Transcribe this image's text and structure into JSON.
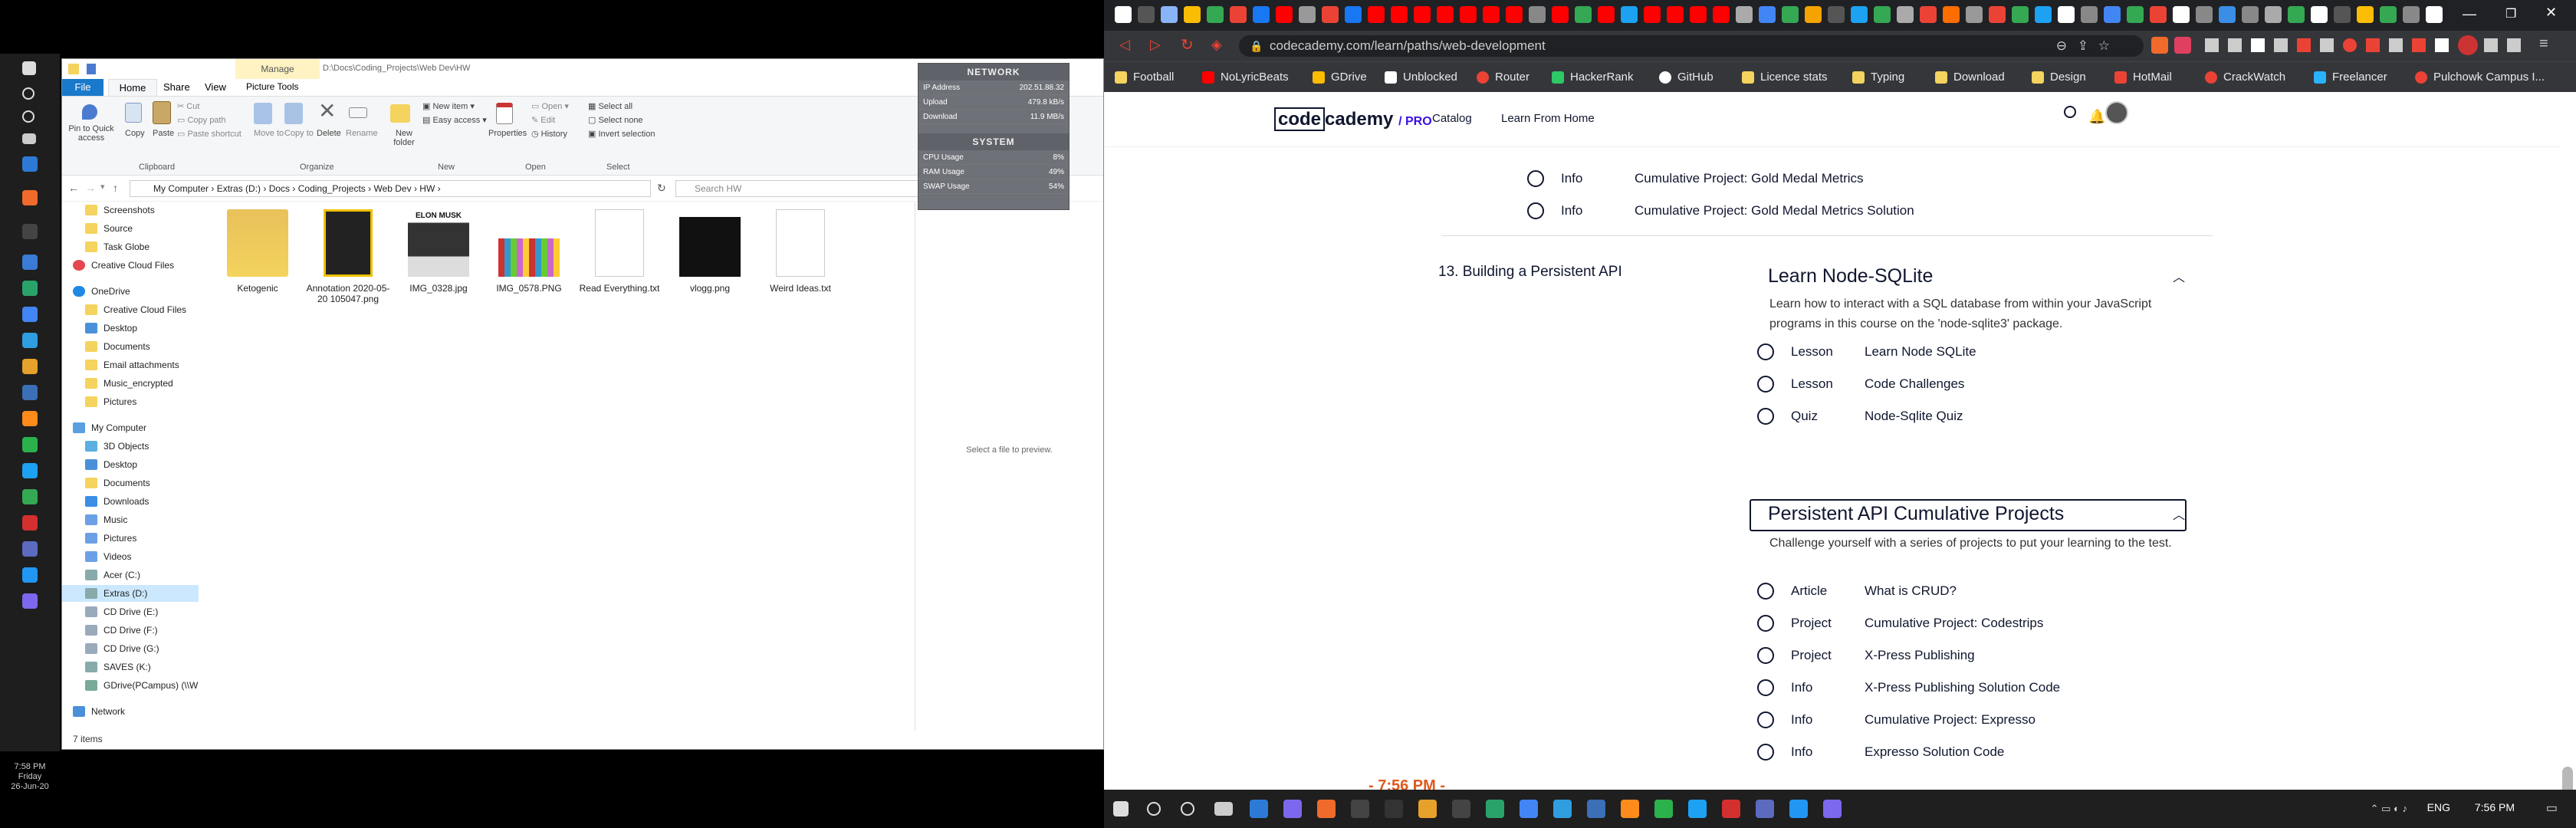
{
  "explorer": {
    "title_path": "D:\\Docs\\Coding_Projects\\Web Dev\\HW",
    "manage_label": "Manage",
    "tabs": [
      "File",
      "Home",
      "Share",
      "View",
      "Picture Tools"
    ],
    "ribbon": {
      "pin": "Pin to Quick access",
      "copy": "Copy",
      "paste": "Paste",
      "cut": "Cut",
      "copy_path": "Copy path",
      "paste_shortcut": "Paste shortcut",
      "move_to": "Move to",
      "copy_to": "Copy to",
      "delete": "Delete",
      "rename": "Rename",
      "new_folder": "New folder",
      "new_item": "New item",
      "easy_access": "Easy access",
      "properties": "Properties",
      "open": "Open",
      "edit": "Edit",
      "history": "History",
      "select_all": "Select all",
      "select_none": "Select none",
      "invert": "Invert selection",
      "groups": [
        "Clipboard",
        "Organize",
        "New",
        "Open",
        "Select"
      ]
    },
    "breadcrumb": [
      "My Computer",
      "Extras (D:)",
      "Docs",
      "Coding_Projects",
      "Web Dev",
      "HW"
    ],
    "search_placeholder": "Search HW",
    "nav": [
      "Screenshots",
      "Source",
      "Task Globe",
      "Creative Cloud Files",
      "OneDrive",
      "Creative Cloud Files",
      "Desktop",
      "Documents",
      "Email attachments",
      "Music_encrypted",
      "Pictures",
      "My Computer",
      "3D Objects",
      "Desktop",
      "Documents",
      "Downloads",
      "Music",
      "Pictures",
      "Videos",
      "Acer (C:)",
      "Extras (D:)",
      "CD Drive (E:)",
      "CD Drive (F:)",
      "CD Drive (G:)",
      "SAVES (K:)",
      "GDrive(PCampus) (\\\\W",
      "Network"
    ],
    "files": [
      {
        "name": "Ketogenic",
        "kind": "folder"
      },
      {
        "name": "Annotation 2020-05-20 105047.png",
        "kind": "phone"
      },
      {
        "name": "IMG_0328.jpg",
        "kind": "elon"
      },
      {
        "name": "IMG_0578.PNG",
        "kind": "grid"
      },
      {
        "name": "Read Everything.txt",
        "kind": "txt"
      },
      {
        "name": "vlogg.png",
        "kind": "dark"
      },
      {
        "name": "Weird Ideas.txt",
        "kind": "txt"
      }
    ],
    "elon_caption": "ELON MUSK",
    "preview_text": "Select a file to preview.",
    "status": "7 items"
  },
  "widget": {
    "network_title": "NETWORK",
    "network_rows": [
      [
        "IP Address",
        "202.51.88.32"
      ],
      [
        "Upload",
        "479.8 kB/s"
      ],
      [
        "Download",
        "11.9 MB/s"
      ]
    ],
    "system_title": "SYSTEM",
    "system_rows": [
      [
        "CPU Usage",
        "8%"
      ],
      [
        "RAM Usage",
        "49%"
      ],
      [
        "SWAP Usage",
        "54%"
      ]
    ]
  },
  "left_clock": {
    "time": "7:58 PM",
    "day": "Friday",
    "date": "26-Jun-20"
  },
  "browser": {
    "url": "codecademy.com/learn/paths/web-development",
    "bookmarks": [
      "Football",
      "NoLyricBeats",
      "GDrive",
      "Unblocked",
      "Router",
      "HackerRank",
      "GitHub",
      "Licence stats",
      "Typing",
      "Download",
      "Design",
      "HotMail",
      "CrackWatch",
      "Freelancer",
      "Pulchowk Campus I..."
    ]
  },
  "cc": {
    "logo_a": "code",
    "logo_b": "cademy",
    "logo_pro": "/ PRO",
    "nav": [
      "Catalog",
      "Learn From Home"
    ],
    "top_rows": [
      [
        "Info",
        "Cumulative Project: Gold Medal Metrics"
      ],
      [
        "Info",
        "Cumulative Project: Gold Medal Metrics Solution"
      ]
    ],
    "unit_label": "13. Building a Persistent API",
    "s1_title": "Learn Node-SQLite",
    "s1_desc": "Learn how to interact with a SQL database from within your JavaScript programs in this course on the 'node-sqlite3' package.",
    "s1_rows": [
      [
        "Lesson",
        "Learn Node SQLite"
      ],
      [
        "Lesson",
        "Code Challenges"
      ],
      [
        "Quiz",
        "Node-Sqlite Quiz"
      ]
    ],
    "s2_title": "Persistent API Cumulative Projects",
    "s2_desc": "Challenge yourself with a series of projects to put your learning to the test.",
    "s2_rows": [
      [
        "Article",
        "What is CRUD?"
      ],
      [
        "Project",
        "Cumulative Project: Codestrips"
      ],
      [
        "Project",
        "X-Press Publishing"
      ],
      [
        "Info",
        "X-Press Publishing Solution Code"
      ],
      [
        "Info",
        "Cumulative Project: Expresso"
      ],
      [
        "Info",
        "Expresso Solution Code"
      ]
    ]
  },
  "overlay_time": "- 7:56 PM -",
  "taskbar": {
    "lang": "ENG",
    "time": "7:56 PM"
  }
}
